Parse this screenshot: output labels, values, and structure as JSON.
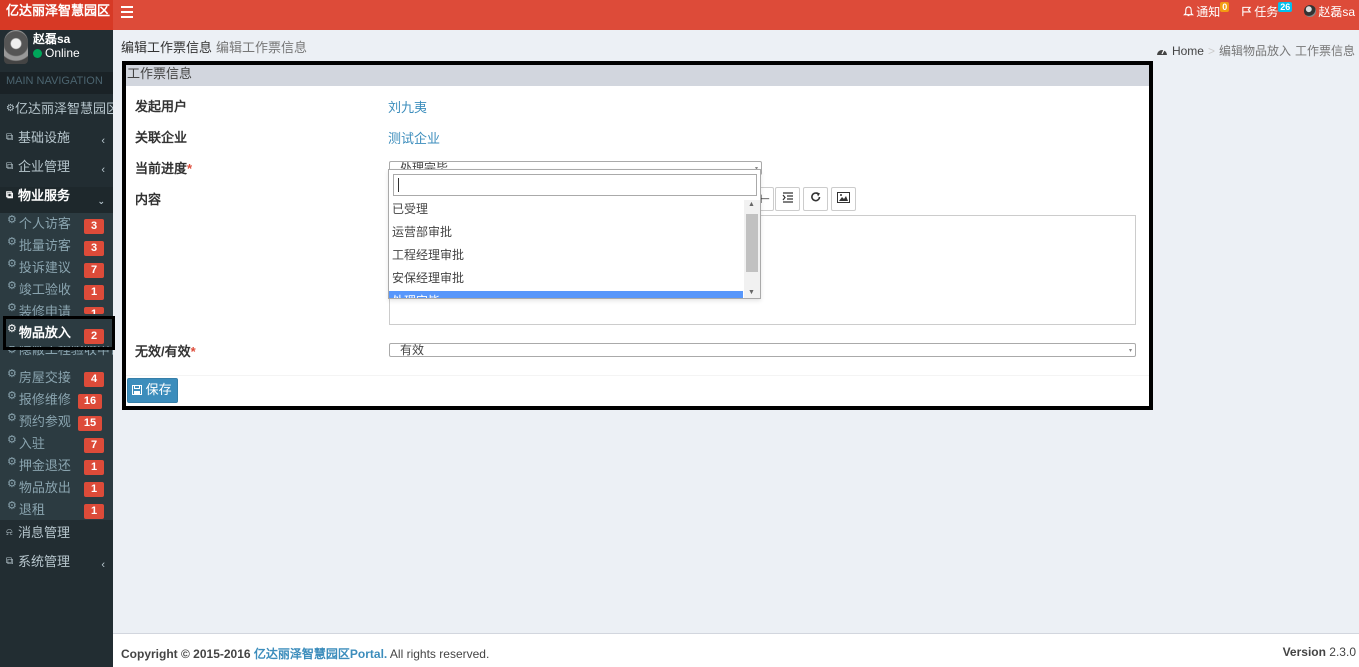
{
  "app": {
    "logo_text": "亿达丽泽智慧园区"
  },
  "navbar": {
    "notify_label": "通知",
    "notify_count": "0",
    "task_label": "任务",
    "task_count": "26",
    "user_name": "赵磊sa",
    "colors": {
      "notify_badge": "#f39c12",
      "task_badge": "#00c0ef"
    }
  },
  "sidebar": {
    "user_name": "赵磊sa",
    "status": "Online",
    "header": "MAIN NAVIGATION",
    "top_items": [
      {
        "label": "亿达丽泽智慧园区",
        "icon": "dashboard-icon"
      },
      {
        "label": "基础设施",
        "icon": "copy-icon"
      },
      {
        "label": "企业管理",
        "icon": "copy-icon"
      },
      {
        "label": "物业服务",
        "icon": "copy-icon"
      }
    ],
    "sub_items": [
      {
        "label": "个人访客",
        "badge": "3"
      },
      {
        "label": "批量访客",
        "badge": "3"
      },
      {
        "label": "投诉建议",
        "badge": "7"
      },
      {
        "label": "竣工验收",
        "badge": "1"
      },
      {
        "label": "装修申请",
        "badge": "1"
      },
      {
        "label": "物品放入",
        "badge": "2"
      },
      {
        "label": "隐蔽工程验收申请",
        "badge": ""
      },
      {
        "label": "房屋交接",
        "badge": "4"
      },
      {
        "label": "报修维修",
        "badge": "16"
      },
      {
        "label": "预约参观",
        "badge": "15"
      },
      {
        "label": "入驻",
        "badge": "7"
      },
      {
        "label": "押金退还",
        "badge": "1"
      },
      {
        "label": "物品放出",
        "badge": "1"
      },
      {
        "label": "退租",
        "badge": "1"
      }
    ],
    "bottom_items": [
      {
        "label": "消息管理",
        "icon": "bell-icon"
      },
      {
        "label": "系统管理",
        "icon": "copy-icon"
      }
    ]
  },
  "content": {
    "title": "编辑工作票信息",
    "subtitle": "编辑工作票信息",
    "breadcrumb": {
      "home": "Home",
      "item1": "编辑物品放入",
      "item2": "工作票信息"
    }
  },
  "form": {
    "box_title": "工作票信息",
    "initiator_label": "发起用户",
    "initiator_value": "刘九夷",
    "company_label": "关联企业",
    "company_value": "测试企业",
    "progress_label": "当前进度",
    "progress_value": "处理完毕",
    "content_label": "内容",
    "valid_label": "无效/有效",
    "valid_value": "有效",
    "save_label": "保存"
  },
  "dropdown": {
    "search_value": "",
    "options": [
      "已受理",
      "运营部审批",
      "工程经理审批",
      "安保经理审批",
      "处理完毕"
    ],
    "selected_index": 4
  },
  "footer": {
    "copyright_prefix": "Copyright © 2015-2016",
    "brand": "亿达丽泽智慧园区Portal.",
    "rights": "All rights reserved.",
    "version_label": "Version",
    "version_value": "2.3.0"
  }
}
